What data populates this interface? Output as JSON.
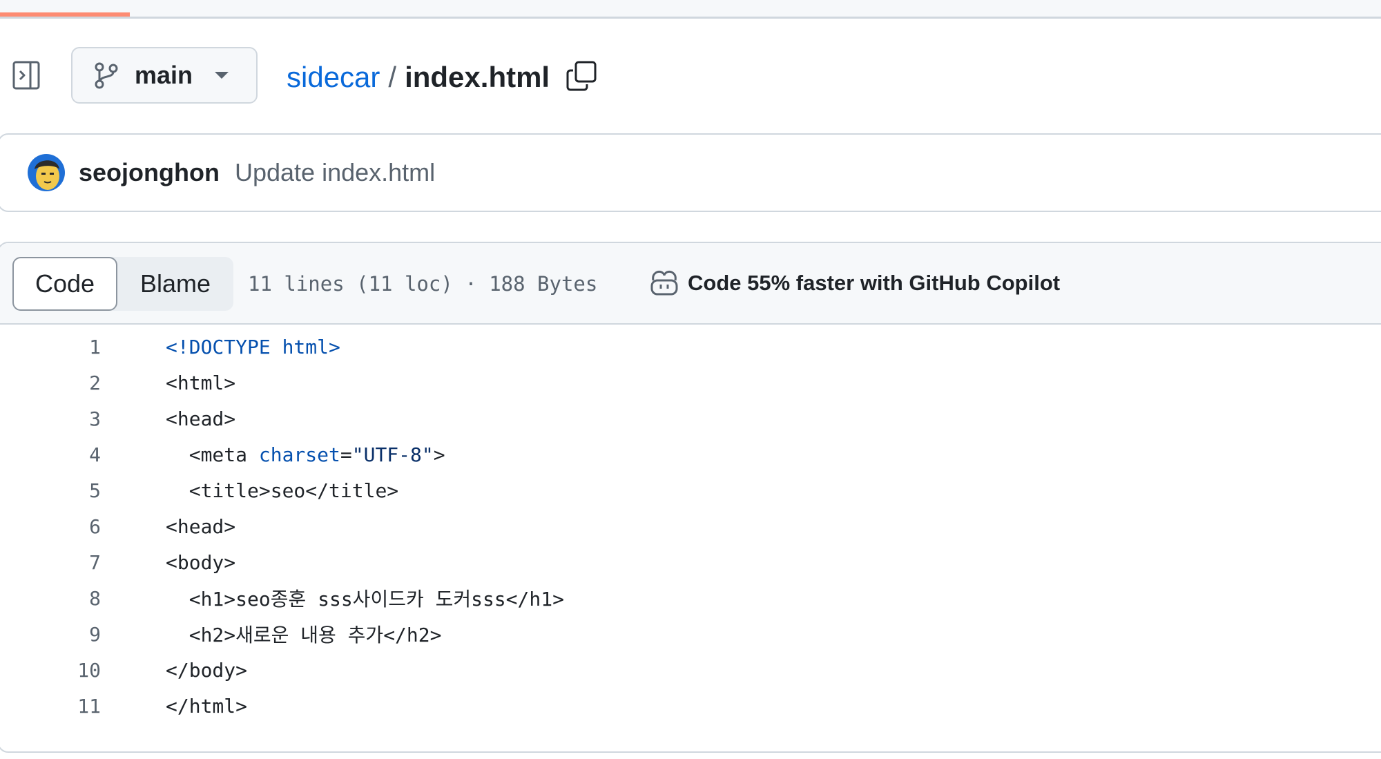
{
  "header": {
    "branch": "main",
    "breadcrumb": {
      "repo": "sidecar",
      "separator": "/",
      "file": "index.html"
    }
  },
  "commit": {
    "author": "seojonghon",
    "message": "Update index.html"
  },
  "file_view": {
    "tabs": [
      "Code",
      "Blame"
    ],
    "active_tab": "Code",
    "meta": "11 lines (11 loc) · 188 Bytes",
    "copilot_label": "Code 55% faster with GitHub Copilot"
  },
  "code": {
    "lines": [
      {
        "num": "1",
        "tokens": [
          {
            "t": "<!DOCTYPE html>",
            "c": "kw"
          }
        ]
      },
      {
        "num": "2",
        "tokens": [
          {
            "t": "<html>",
            "c": "pl"
          }
        ]
      },
      {
        "num": "3",
        "tokens": [
          {
            "t": "<head>",
            "c": "pl"
          }
        ]
      },
      {
        "num": "4",
        "tokens": [
          {
            "t": "  <meta ",
            "c": "pl"
          },
          {
            "t": "charset",
            "c": "at"
          },
          {
            "t": "=",
            "c": "pl"
          },
          {
            "t": "\"UTF-8\"",
            "c": "st"
          },
          {
            "t": ">",
            "c": "pl"
          }
        ]
      },
      {
        "num": "5",
        "tokens": [
          {
            "t": "  <title>",
            "c": "pl"
          },
          {
            "t": "seo",
            "c": "pl"
          },
          {
            "t": "</title>",
            "c": "pl"
          }
        ]
      },
      {
        "num": "6",
        "tokens": [
          {
            "t": "<head>",
            "c": "pl"
          }
        ]
      },
      {
        "num": "7",
        "tokens": [
          {
            "t": "<body>",
            "c": "pl"
          }
        ]
      },
      {
        "num": "8",
        "tokens": [
          {
            "t": "  <h1>",
            "c": "pl"
          },
          {
            "t": "seo종훈 sss사이드카 도커sss",
            "c": "pl"
          },
          {
            "t": "</h1>",
            "c": "pl"
          }
        ]
      },
      {
        "num": "9",
        "tokens": [
          {
            "t": "  <h2>",
            "c": "pl"
          },
          {
            "t": "새로운 내용 추가",
            "c": "pl"
          },
          {
            "t": "</h2>",
            "c": "pl"
          }
        ]
      },
      {
        "num": "10",
        "tokens": [
          {
            "t": "</body>",
            "c": "pl"
          }
        ]
      },
      {
        "num": "11",
        "tokens": [
          {
            "t": "</html>",
            "c": "pl"
          }
        ]
      }
    ]
  },
  "colors": {
    "link": "#0969da",
    "page_load_bar": "#fd8c73",
    "border": "#d0d7de",
    "muted_text": "#59636e"
  },
  "icons": {
    "sidebar_toggle": "sidebar-expand-icon",
    "branch": "git-branch-icon",
    "caret": "triangle-down-icon",
    "copy": "copy-icon",
    "copilot": "copilot-icon"
  },
  "page_load_progress": 0.094
}
